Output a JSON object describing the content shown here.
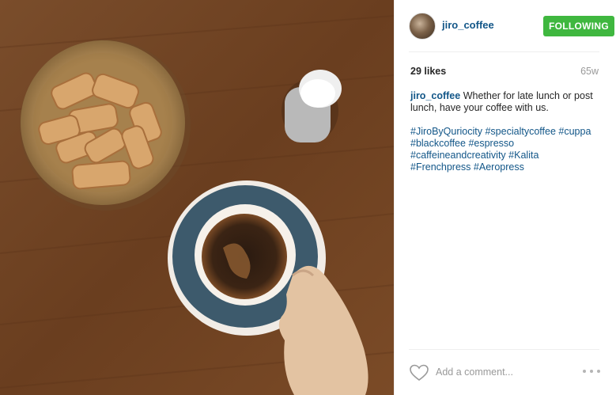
{
  "post": {
    "username": "jiro_coffee",
    "follow_label": "FOLLOWING",
    "likes": "29 likes",
    "age": "65w",
    "caption_text": "Whether for late lunch or post lunch, have your coffee with us.",
    "hashtags": [
      "#JiroByQuriocity",
      "#specialtycoffee",
      "#cuppa",
      "#blackcoffee",
      "#espresso",
      "#caffeineandcreativity",
      "#Kalita",
      "#Frenchpress",
      "#Aeropress"
    ],
    "comment_placeholder": "Add a comment...",
    "accent_color": "#3fb73f",
    "link_color": "#125688"
  },
  "icons": {
    "like": "heart-outline-icon",
    "more": "ellipsis-icon"
  }
}
